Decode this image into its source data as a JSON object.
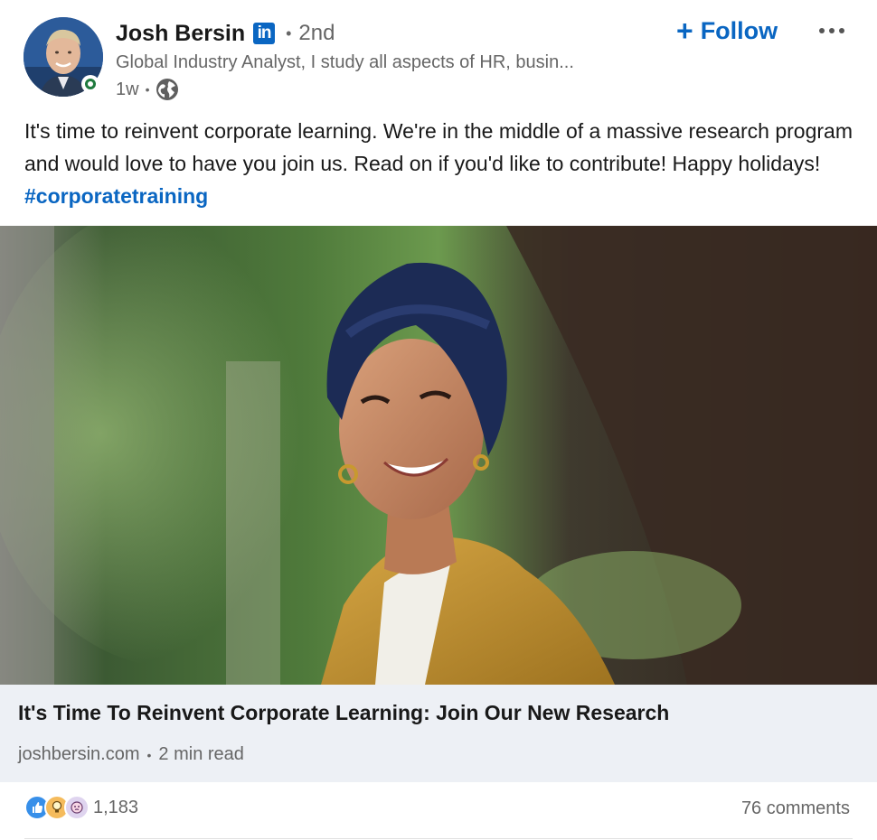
{
  "author": {
    "name": "Josh Bersin",
    "network_badge": "in",
    "degree": "2nd",
    "headline": "Global Industry Analyst, I study all aspects of HR, busin...",
    "time": "1w",
    "visibility_icon": "globe-icon",
    "avatar_icon": "profile-photo",
    "presence_color": "#1f7a3e"
  },
  "actions": {
    "follow_label": "Follow",
    "follow_icon": "plus-icon",
    "more_icon": "ellipsis-icon"
  },
  "post": {
    "text": "It's time to reinvent corporate learning. We're in the middle of a massive research program and would love to have you join us. Read on if you'd like to contribute! Happy holidays!",
    "hashtag": "#corporatetraining"
  },
  "article": {
    "title": "It's Time To Reinvent Corporate Learning: Join Our New Research",
    "source": "joshbersin.com",
    "read_time": "2 min read"
  },
  "social": {
    "reaction_icons": [
      "like-icon",
      "insightful-icon",
      "curious-icon"
    ],
    "reaction_count": "1,183",
    "comments": "76 comments"
  },
  "colors": {
    "brand_blue": "#0a66c2",
    "muted_text": "#666666",
    "card_bg": "#edf0f5"
  }
}
